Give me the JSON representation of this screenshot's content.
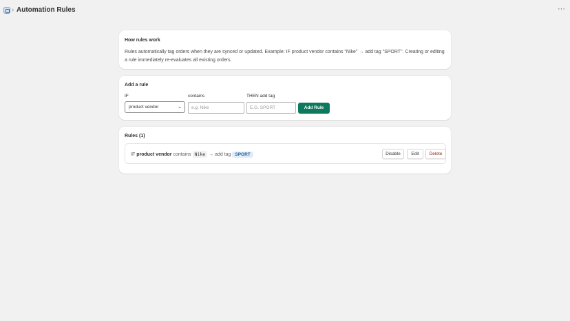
{
  "header": {
    "title": "Automation Rules",
    "app_icon": "app-icon",
    "more_icon": "···"
  },
  "info_card": {
    "heading": "How rules work",
    "body": "Rules automatically tag orders when they are synced or updated. Example: IF product vendor contains \"Nike\" → add tag \"SPORT\". Creating or editing a rule immediately re-evaluates all existing orders."
  },
  "add_rule": {
    "heading": "Add a rule",
    "if_label": "IF",
    "contains_label": "contains",
    "then_label": "THEN add tag",
    "field_value": "product vendor",
    "contains_placeholder": "e.g. Nike",
    "tag_placeholder": "E.G. SPORT",
    "submit_label": "Add Rule"
  },
  "rules": {
    "heading": "Rules (1)",
    "items": [
      {
        "if_word": "IF",
        "field": "product vendor",
        "operator": "contains",
        "value": "Nike",
        "arrow": "→ add tag",
        "tag": "SPORT",
        "disable_label": "Disable",
        "edit_label": "Edit",
        "delete_label": "Delete"
      }
    ]
  },
  "colors": {
    "background": "#f1f1f1",
    "primary": "#0d7a5f",
    "tag_bg": "#e0ecf9",
    "tag_text": "#1f5f9a",
    "danger": "#8e1f0b"
  }
}
